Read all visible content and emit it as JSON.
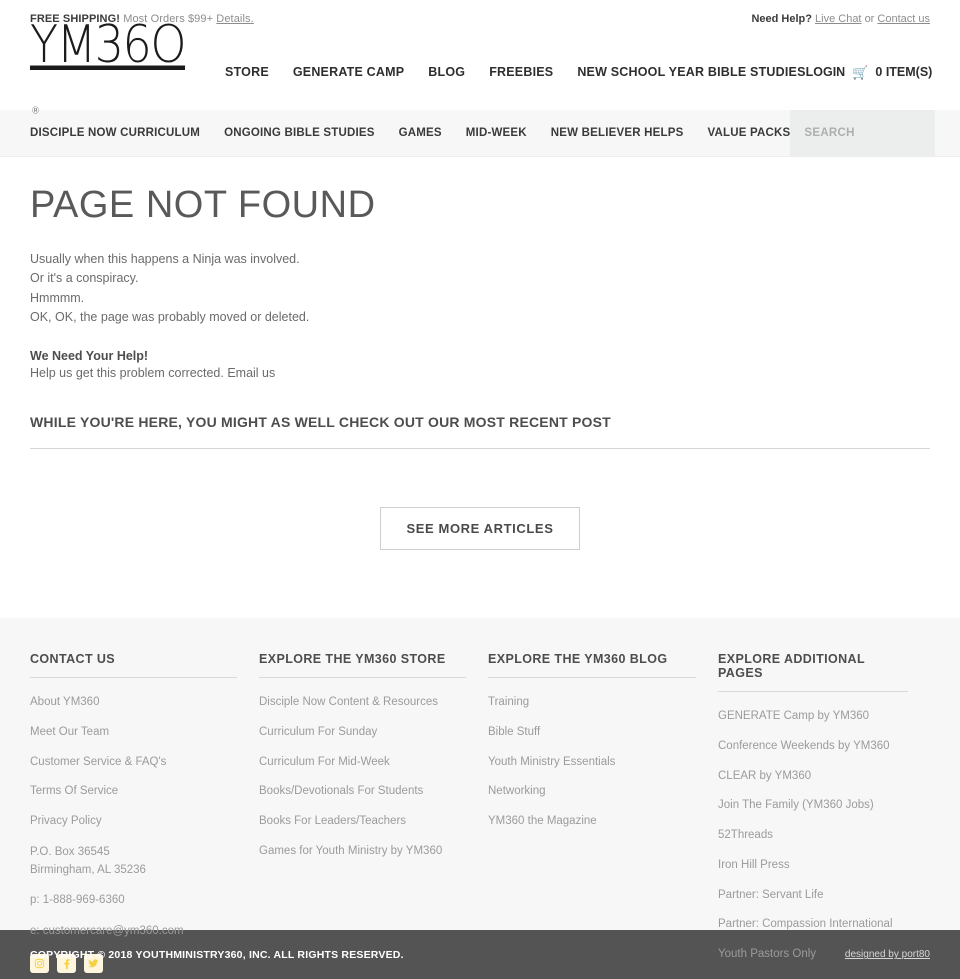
{
  "topbar": {
    "shipping_strong": "FREE SHIPPING!",
    "shipping_rest": "Most Orders $99+",
    "shipping_link": "Details.",
    "help_strong": "Need Help?",
    "help_link1": "Live Chat",
    "help_or": "or",
    "help_link2": "Contact us"
  },
  "masthead": {
    "logo_text": "YM36O",
    "logo_tm": "®",
    "nav": [
      {
        "label": "STORE"
      },
      {
        "label": "GENERATE CAMP"
      },
      {
        "label": "BLOG"
      },
      {
        "label": "FREEBIES"
      },
      {
        "label": "NEW SCHOOL YEAR BIBLE STUDIES"
      }
    ],
    "login_label": "LOGIN",
    "cart_icon": "cart-icon",
    "cart_label": "0 ITEM(S)"
  },
  "catnav": {
    "items": [
      {
        "label": "DISCIPLE NOW CURRICULUM"
      },
      {
        "label": "ONGOING BIBLE STUDIES"
      },
      {
        "label": "GAMES"
      },
      {
        "label": "MID-WEEK"
      },
      {
        "label": "NEW BELIEVER HELPS"
      },
      {
        "label": "VALUE PACKS"
      }
    ],
    "search_placeholder": "SEARCH",
    "search_value": "",
    "search_icon": "search-icon"
  },
  "main": {
    "page_title": "PAGE NOT FOUND",
    "blurb_line1": "Usually when this happens a Ninja was involved.",
    "blurb_line2": "Or it's a conspiracy.",
    "blurb_line3": "Hmmmm.",
    "blurb_line4": "OK, OK, the page was probably moved or deleted.",
    "help_heading": "We Need Your Help!",
    "help_text": "Help us get this problem corrected.",
    "help_link": "Email us",
    "recent_heading": "WHILE YOU'RE HERE, YOU MIGHT AS WELL CHECK OUT OUR MOST RECENT POST",
    "see_more_label": "SEE MORE ARTICLES"
  },
  "footer": {
    "columns": [
      {
        "heading": "CONTACT US",
        "links": [
          "About YM360",
          "Meet Our Team",
          "Customer Service & FAQ's",
          "Terms Of Service",
          "Privacy Policy"
        ],
        "address_line1": "P.O. Box 36545",
        "address_line2": "Birmingham, AL 35236",
        "phone": "p: 1-888-969-6360",
        "email": "e: customercare@ym360.com",
        "social": [
          {
            "name": "instagram-icon"
          },
          {
            "name": "facebook-icon"
          },
          {
            "name": "twitter-icon"
          }
        ]
      },
      {
        "heading": "EXPLORE THE YM360 STORE",
        "links": [
          "Disciple Now Content & Resources",
          "Curriculum For Sunday",
          "Curriculum For Mid-Week",
          "Books/Devotionals For Students",
          "Books For Leaders/Teachers",
          "Games for Youth Ministry by YM360"
        ]
      },
      {
        "heading": "EXPLORE THE YM360 BLOG",
        "links": [
          "Training",
          "Bible Stuff",
          "Youth Ministry Essentials",
          "Networking",
          "YM360 the Magazine"
        ]
      },
      {
        "heading": "EXPLORE ADDITIONAL PAGES",
        "links": [
          "GENERATE Camp by YM360",
          "Conference Weekends by YM360",
          "CLEAR by YM360",
          "Join The Family (YM360 Jobs)",
          "52Threads",
          "Iron Hill Press",
          "Partner: Servant Life",
          "Partner: Compassion International",
          "Youth Pastors Only"
        ]
      }
    ]
  },
  "copyright": {
    "text": "COPYRIGHT © 2018 YOUTHMINISTRY360, INC. ALL RIGHTS RESERVED.",
    "credit": "designed by port80"
  },
  "colors": {
    "accent_yellow": "#f2c200",
    "social_yellow": "#f5d142",
    "nav_bg": "#f7f7f7",
    "search_bg": "#eceded",
    "footer_bg": "#f7f7f8",
    "copyright_bg": "#545454"
  }
}
